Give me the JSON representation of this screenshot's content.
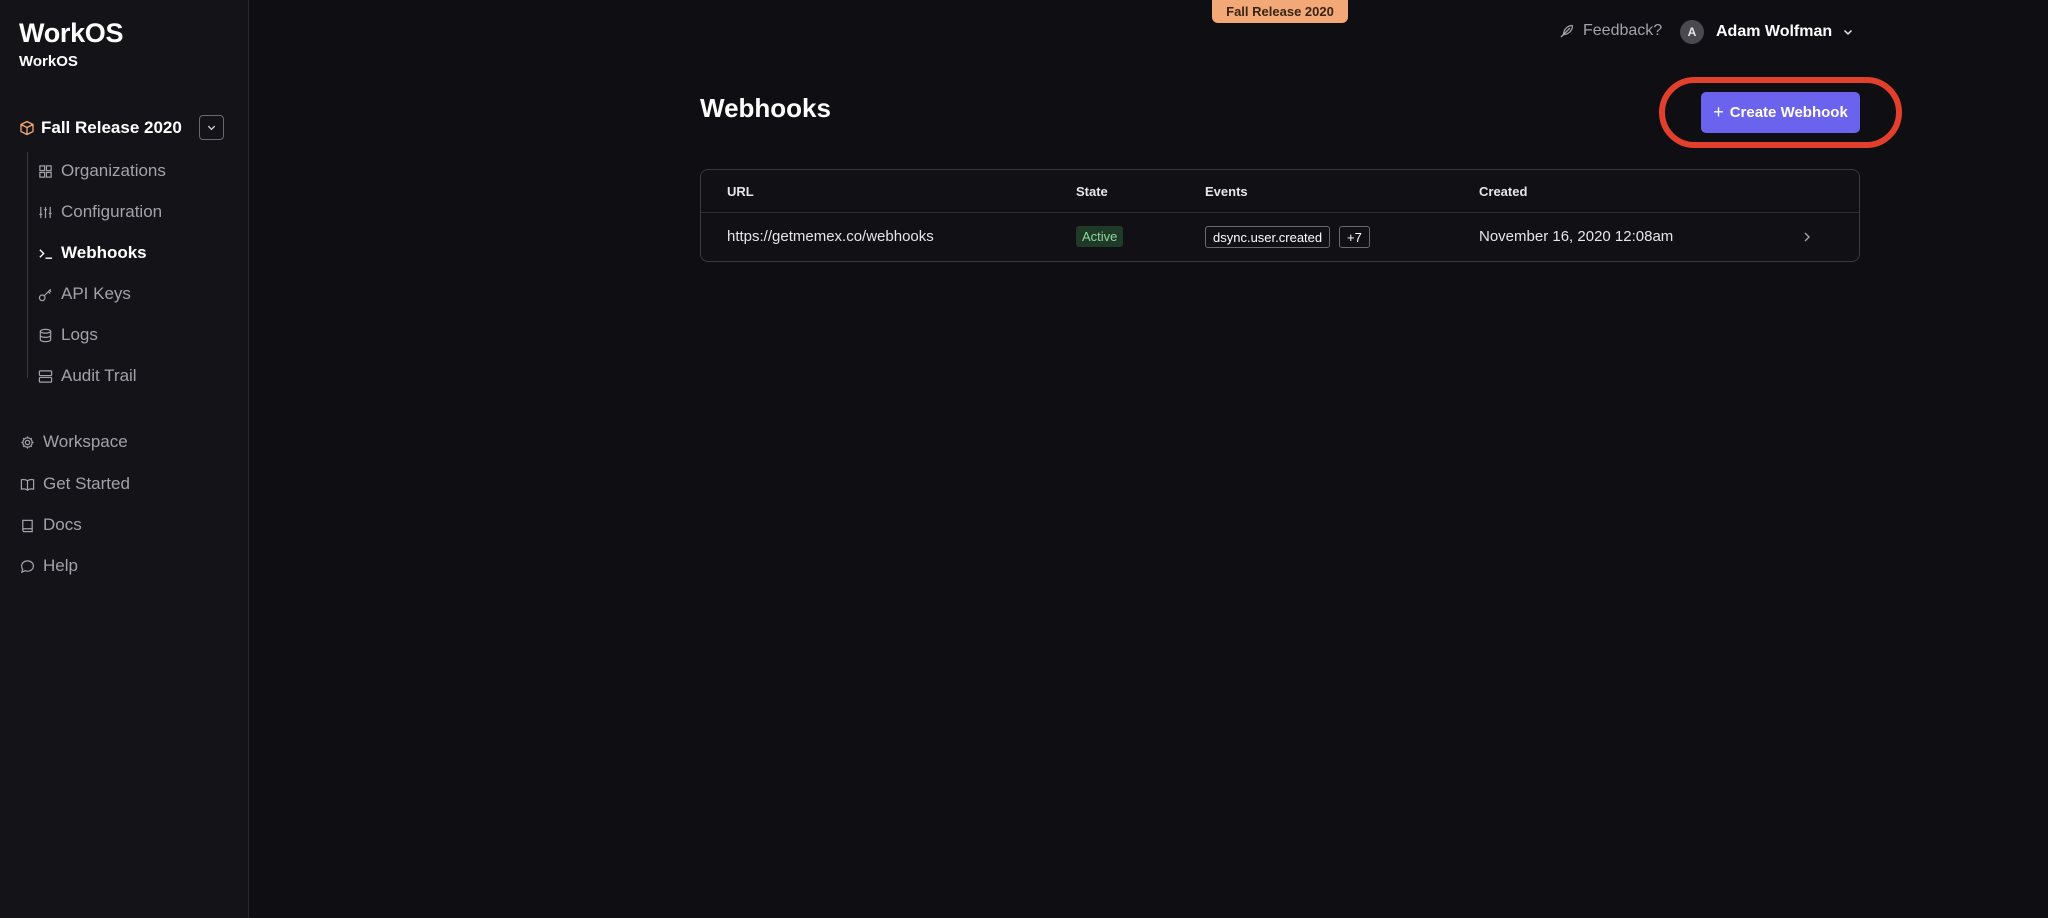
{
  "app": {
    "title": "WorkOS",
    "subtitle": "WorkOS"
  },
  "project": {
    "name": "Fall Release 2020",
    "icon": "cube-icon"
  },
  "sidebar": {
    "items": [
      {
        "label": "Organizations",
        "icon": "grid-icon"
      },
      {
        "label": "Configuration",
        "icon": "sliders-icon"
      },
      {
        "label": "Webhooks",
        "icon": "terminal-icon",
        "active": true
      },
      {
        "label": "API Keys",
        "icon": "key-icon"
      },
      {
        "label": "Logs",
        "icon": "database-icon"
      },
      {
        "label": "Audit Trail",
        "icon": "server-icon"
      }
    ],
    "workspace_items": [
      {
        "label": "Workspace",
        "icon": "gear-icon"
      },
      {
        "label": "Get Started",
        "icon": "book-open-icon"
      },
      {
        "label": "Docs",
        "icon": "book-icon"
      },
      {
        "label": "Help",
        "icon": "chat-bubble-icon"
      }
    ]
  },
  "header": {
    "release_banner": "Fall Release 2020",
    "feedback_label": "Feedback?",
    "user": {
      "initial": "A",
      "name": "Adam Wolfman"
    }
  },
  "main": {
    "title": "Webhooks",
    "create_button_label": "Create Webhook",
    "table": {
      "columns": [
        "URL",
        "State",
        "Events",
        "Created"
      ],
      "rows": [
        {
          "url": "https://getmemex.co/webhooks",
          "state": "Active",
          "event": "dsync.user.created",
          "more_events": "+7",
          "created": "November 16, 2020 12:08am"
        }
      ]
    }
  },
  "colors": {
    "accent": "#6b63ee",
    "highlight_ring": "#e2402c",
    "banner": "#f3a977",
    "active_badge_bg": "#1f3a26",
    "active_badge_text": "#8fd6a0"
  }
}
